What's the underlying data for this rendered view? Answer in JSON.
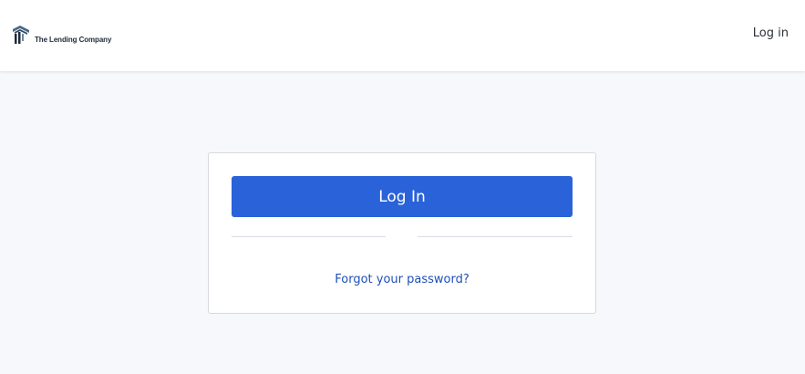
{
  "header": {
    "logo_text": "The Lending Company",
    "login_link": "Log in"
  },
  "card": {
    "login_button": "Log In",
    "forgot_password": "Forgot your password?"
  },
  "colors": {
    "primary": "#2a62d9",
    "link": "#1e4fb8",
    "background": "#f7f8fb",
    "logo_dark": "#1f2a3a"
  }
}
